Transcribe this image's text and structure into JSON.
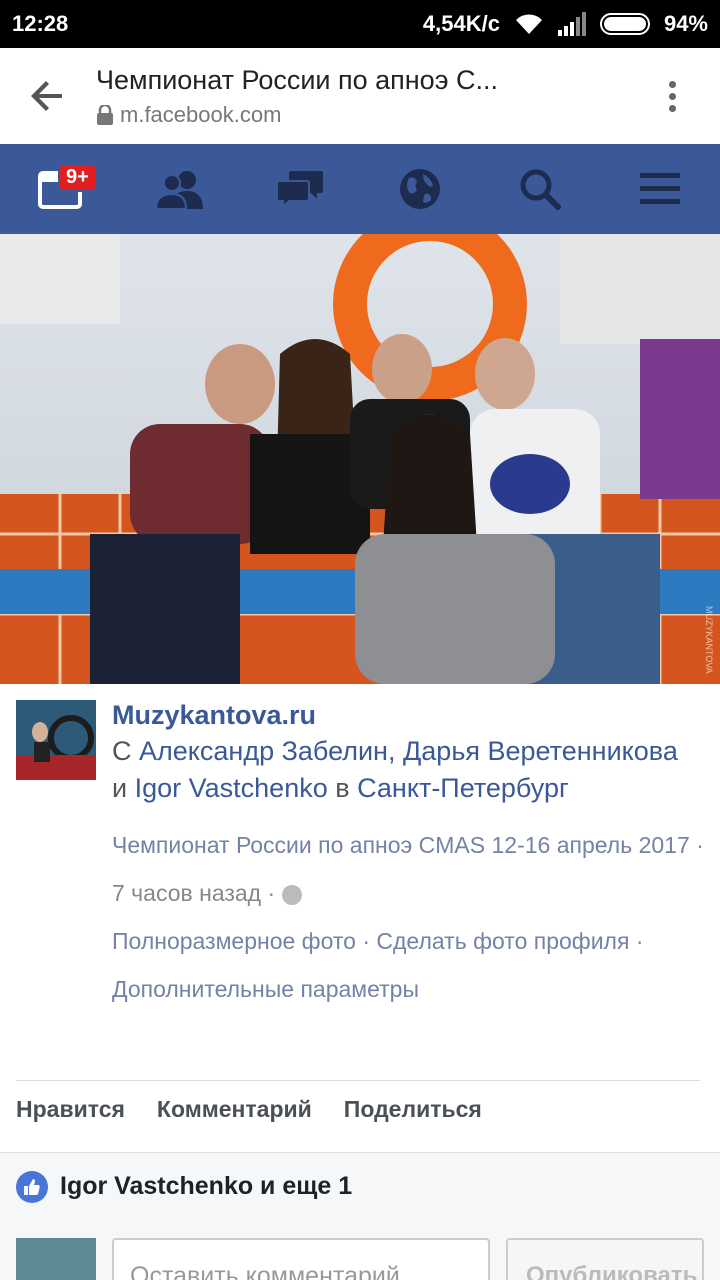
{
  "status_bar": {
    "time": "12:28",
    "network_speed": "4,54K/c",
    "battery": "94%",
    "battery_level": 0.94
  },
  "browser": {
    "title": "Чемпионат России по апноэ С...",
    "url": "m.facebook.com"
  },
  "fb_nav": {
    "notifications_badge": "9+",
    "accent_color": "#3b5998",
    "items": [
      "notifications-icon",
      "friends-icon",
      "messages-icon",
      "globe-icon",
      "search-icon",
      "menu-icon"
    ]
  },
  "photo": {
    "watermark": "MUZYKANTOVA"
  },
  "post": {
    "author": "Muzykantova.ru",
    "with_prefix": "С",
    "tagged_1": "Александр Забелин",
    "tagged_sep": ",",
    "tagged_2": "Дарья Веретенникова",
    "and": "и",
    "tagged_3": "Igor Vastchenko",
    "in": "в",
    "location": "Санкт-Петербург",
    "album": "Чемпионат России по апноэ CMAS 12-16 апрель 2017",
    "time_ago": "7 часов назад",
    "dot": "·",
    "full_size": "Полноразмерное фото",
    "make_profile": "Сделать фото профиля",
    "more_options": "Дополнительные параметры"
  },
  "actions": {
    "like": "Нравится",
    "comment": "Комментарий",
    "share": "Поделиться"
  },
  "likes": {
    "text": "Igor Vastchenko и еще 1"
  },
  "comment_box": {
    "placeholder": "Оставить комментарий",
    "publish": "Опубликовать"
  }
}
